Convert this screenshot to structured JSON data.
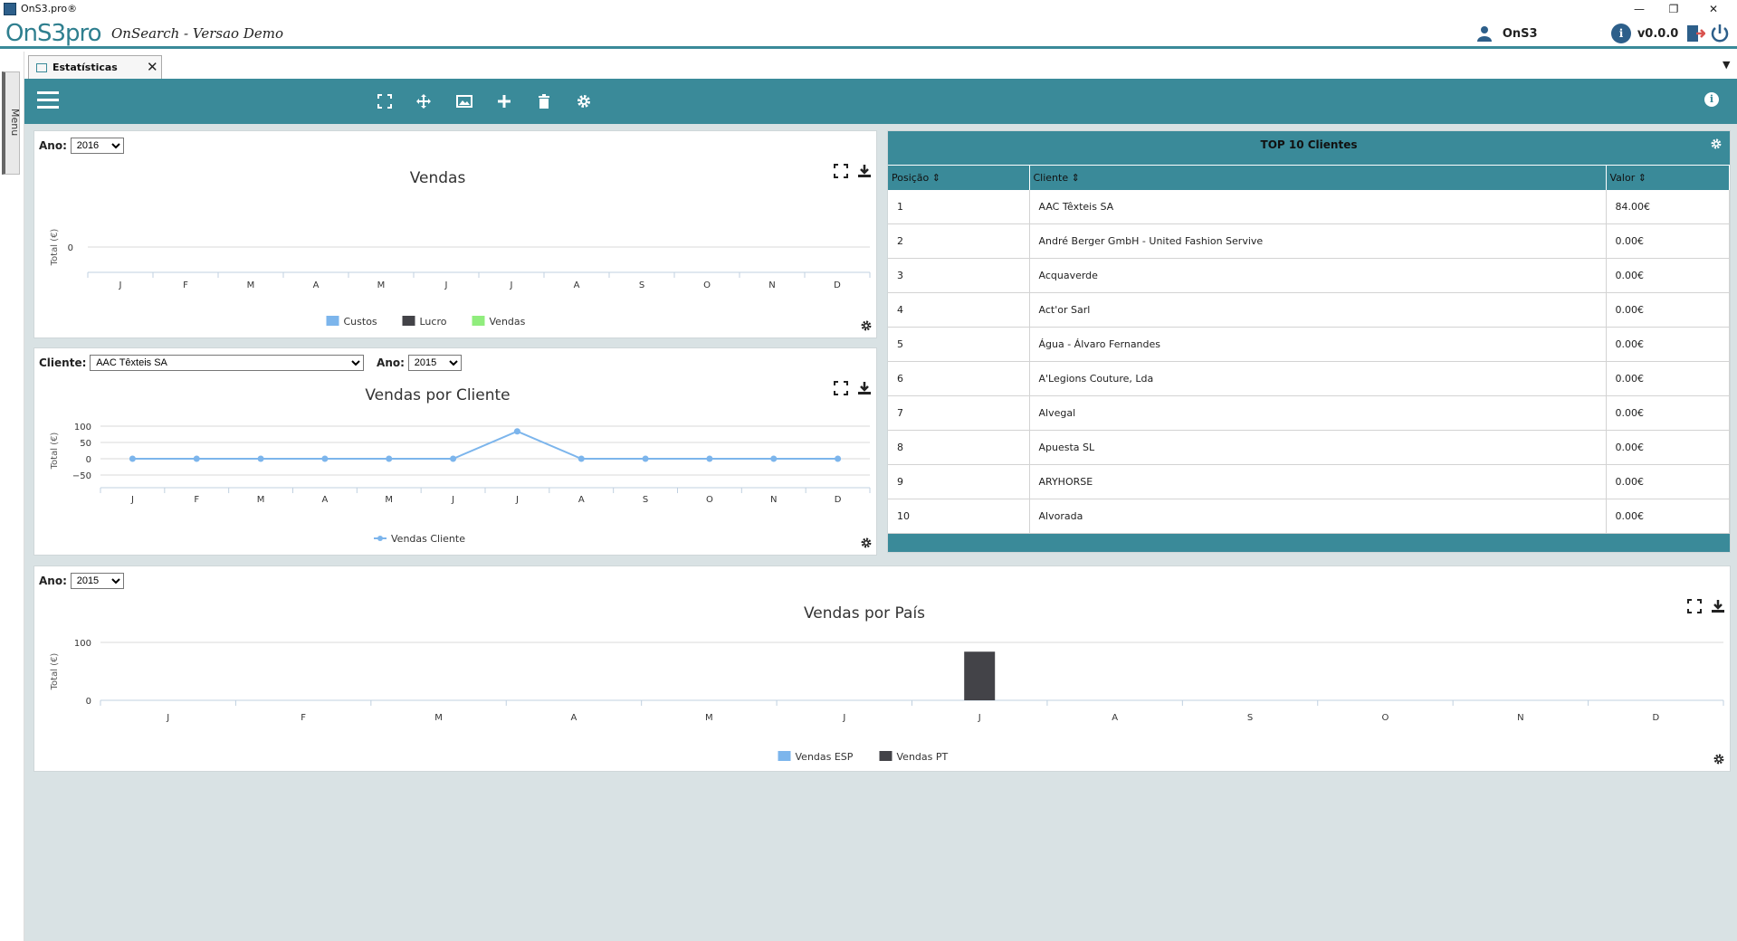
{
  "window": {
    "title": "OnS3.pro®",
    "minimize": "—",
    "restore": "❐",
    "close": "✕"
  },
  "header": {
    "logo": "OnS3pro",
    "subtitle": "OnSearch - Versao Demo",
    "user": "OnS3",
    "version": "v0.0.0"
  },
  "sidebar": {
    "menu_label": "Menu"
  },
  "tab": {
    "label": "Estatísticas",
    "close": "✕"
  },
  "colors": {
    "accent": "#3a8a99",
    "series_blue": "#7cb5ec",
    "series_dark": "#434348",
    "series_green": "#90ed7d"
  },
  "chart_vendas": {
    "filter_label": "Ano:",
    "filter_value": "2016",
    "chart_data": {
      "type": "bar",
      "title": "Vendas",
      "ylabel": "Total (€)",
      "categories": [
        "J",
        "F",
        "M",
        "A",
        "M",
        "J",
        "J",
        "A",
        "S",
        "O",
        "N",
        "D"
      ],
      "yticks": [
        "0"
      ],
      "series": [
        {
          "name": "Custos",
          "values": [
            0,
            0,
            0,
            0,
            0,
            0,
            0,
            0,
            0,
            0,
            0,
            0
          ]
        },
        {
          "name": "Lucro",
          "values": [
            0,
            0,
            0,
            0,
            0,
            0,
            0,
            0,
            0,
            0,
            0,
            0
          ]
        },
        {
          "name": "Vendas",
          "values": [
            0,
            0,
            0,
            0,
            0,
            0,
            0,
            0,
            0,
            0,
            0,
            0
          ]
        }
      ]
    }
  },
  "chart_cliente": {
    "cliente_label": "Cliente:",
    "cliente_value": "AAC Têxteis SA",
    "ano_label": "Ano:",
    "ano_value": "2015",
    "chart_data": {
      "type": "line",
      "title": "Vendas por Cliente",
      "ylabel": "Total (€)",
      "categories": [
        "J",
        "F",
        "M",
        "A",
        "M",
        "J",
        "J",
        "A",
        "S",
        "O",
        "N",
        "D"
      ],
      "ylim": [
        -50,
        100
      ],
      "yticks": [
        "100",
        "50",
        "0",
        "−50"
      ],
      "series": [
        {
          "name": "Vendas Cliente",
          "values": [
            0,
            0,
            0,
            0,
            0,
            0,
            84,
            0,
            0,
            0,
            0,
            0
          ]
        }
      ]
    }
  },
  "chart_pais": {
    "filter_label": "Ano:",
    "filter_value": "2015",
    "chart_data": {
      "type": "bar",
      "title": "Vendas por País",
      "ylabel": "Total (€)",
      "categories": [
        "J",
        "F",
        "M",
        "A",
        "M",
        "J",
        "J",
        "A",
        "S",
        "O",
        "N",
        "D"
      ],
      "ylim": [
        0,
        100
      ],
      "yticks": [
        "100",
        "0"
      ],
      "series": [
        {
          "name": "Vendas ESP",
          "values": [
            0,
            0,
            0,
            0,
            0,
            0,
            0,
            0,
            0,
            0,
            0,
            0
          ]
        },
        {
          "name": "Vendas PT",
          "values": [
            0,
            0,
            0,
            0,
            0,
            0,
            84,
            0,
            0,
            0,
            0,
            0
          ]
        }
      ]
    }
  },
  "top10": {
    "title": "TOP 10 Clientes",
    "columns": [
      "Posição",
      "Cliente",
      "Valor"
    ],
    "rows": [
      {
        "pos": "1",
        "cliente": "AAC Têxteis SA",
        "valor": "84.00€"
      },
      {
        "pos": "2",
        "cliente": "André Berger GmbH - United Fashion Servive",
        "valor": "0.00€"
      },
      {
        "pos": "3",
        "cliente": "Acquaverde",
        "valor": "0.00€"
      },
      {
        "pos": "4",
        "cliente": "Act'or Sarl",
        "valor": "0.00€"
      },
      {
        "pos": "5",
        "cliente": "Água - Álvaro Fernandes",
        "valor": "0.00€"
      },
      {
        "pos": "6",
        "cliente": "A'Legions Couture, Lda",
        "valor": "0.00€"
      },
      {
        "pos": "7",
        "cliente": "Alvegal",
        "valor": "0.00€"
      },
      {
        "pos": "8",
        "cliente": "Apuesta SL",
        "valor": "0.00€"
      },
      {
        "pos": "9",
        "cliente": "ARYHORSE",
        "valor": "0.00€"
      },
      {
        "pos": "10",
        "cliente": "Alvorada",
        "valor": "0.00€"
      }
    ]
  }
}
